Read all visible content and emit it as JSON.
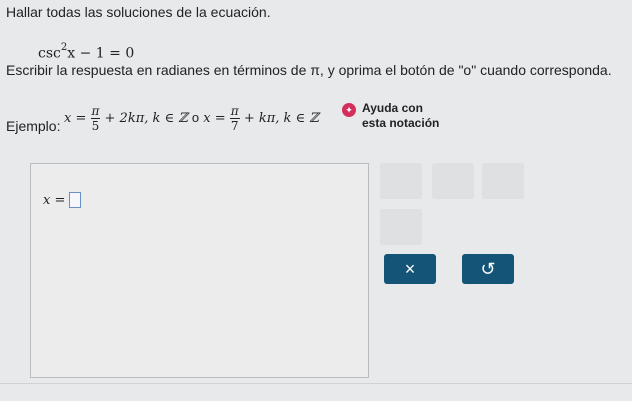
{
  "question": {
    "title": "Hallar todas las soluciones de la ecuación.",
    "equation": {
      "base": "csc",
      "exp": "2",
      "rest": "x − 1 = 0"
    },
    "instructions": "Escribir la respuesta en radianes en términos de π, y oprima el botón de \"o\" cuando corresponda.",
    "example_label": "Ejemplo:",
    "example": {
      "part1_prefix": "x =",
      "frac1_num": "π",
      "frac1_den": "5",
      "part1_suffix": "+ 2kπ, k ∈ ℤ",
      "connector": "o",
      "part2_prefix": "x =",
      "frac2_num": "π",
      "frac2_den": "7",
      "part2_suffix": "+ kπ, k ∈ ℤ"
    }
  },
  "help": {
    "line1": "Ayuda con",
    "line2": "esta notación",
    "icon": "lightbulb-icon"
  },
  "answer": {
    "label": "x =",
    "value": ""
  },
  "toolbar": {
    "clear_label": "×",
    "undo_label": "↺"
  }
}
